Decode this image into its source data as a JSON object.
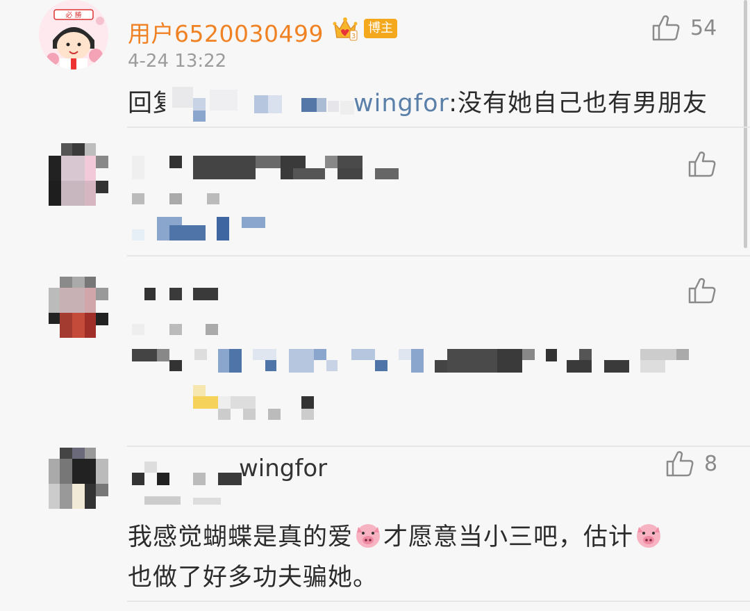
{
  "comments": [
    {
      "username": "用户6520030499",
      "badge": "博主",
      "time": "4-24 13:22",
      "reply_prefix": "回复",
      "reply_target_tail": "wingfor",
      "reply_text": ":没有她自己也有男朋友",
      "likes": "54"
    },
    {
      "likes": ""
    },
    {
      "likes": ""
    },
    {
      "username_tail": "wingfor",
      "body_line1_a": "我感觉蝴蝶是真的爱",
      "body_line1_b": "才愿意当小三吧，估计",
      "body_line2": "也做了好多功夫骗她。",
      "likes": "8"
    }
  ],
  "icons": {
    "like": "thumbs-up-icon",
    "vip": "crown-icon",
    "emoji": "pig-face-emoji"
  },
  "colors": {
    "username": "#f08224",
    "badge": "#f4a81d",
    "link": "#5a7fa8",
    "text": "#2b2b2b",
    "meta": "#9b9b9b",
    "background": "#f7f7f7"
  }
}
